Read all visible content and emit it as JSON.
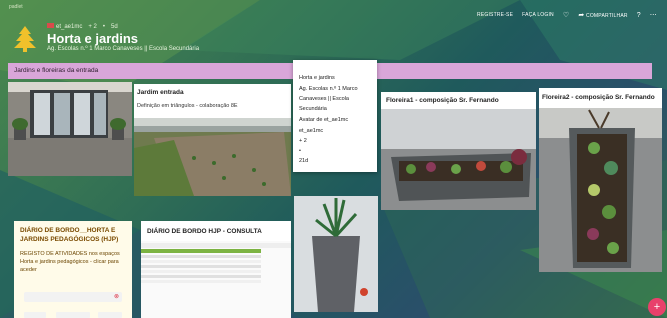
{
  "app": {
    "brand": "padlet"
  },
  "header": {
    "author": "et_ae1mc",
    "plus": "+ 2",
    "age": "5d",
    "title": "Horta e jardins",
    "subtitle": "Ag. Escolas n.º 1 Marco Canaveses || Escola Secundária"
  },
  "nav": {
    "register": "REGISTRE-SE",
    "login": "FAÇA LOGIN",
    "share": "COMPARTILHAR",
    "help_icon": "help-icon",
    "more_icon": "more-icon",
    "heart_icon": "heart-icon"
  },
  "section": {
    "title": "Jardins e floreiras da entrada"
  },
  "posts": {
    "jardim_title": "Jardim entrada",
    "jardim_text": "Definição em triângulos - colaboração 8E",
    "floreira1_title": "Floreira1 - composição Sr. Fernando",
    "floreira2_title": "Floreira2 - composição Sr. Fernando",
    "consulta_title": "DIÁRIO DE BORDO HJP - CONSULTA",
    "diario_title": "DIÁRIO DE BORDO__HORTA E JARDINS PEDAGÓGICOS (HJP)",
    "diario_text": "REGISTO DE ATIVIDADES nos espaços Horta e jardins pedagógicos - clicar para aceder"
  },
  "tooltip": {
    "l1": "Horta e jardins",
    "l2": "Ag. Escolas n.º 1 Marco",
    "l3": "Canaveses || Escola",
    "l4": "Secundária",
    "l5": "Avatar de et_ae1mc",
    "l6": "et_ae1mc",
    "l7": "+ 2",
    "l8": "•",
    "l9": "21d"
  },
  "colors": {
    "accent": "#e8416b",
    "section": "#d9a6d9",
    "diario": "#fffbe9"
  }
}
